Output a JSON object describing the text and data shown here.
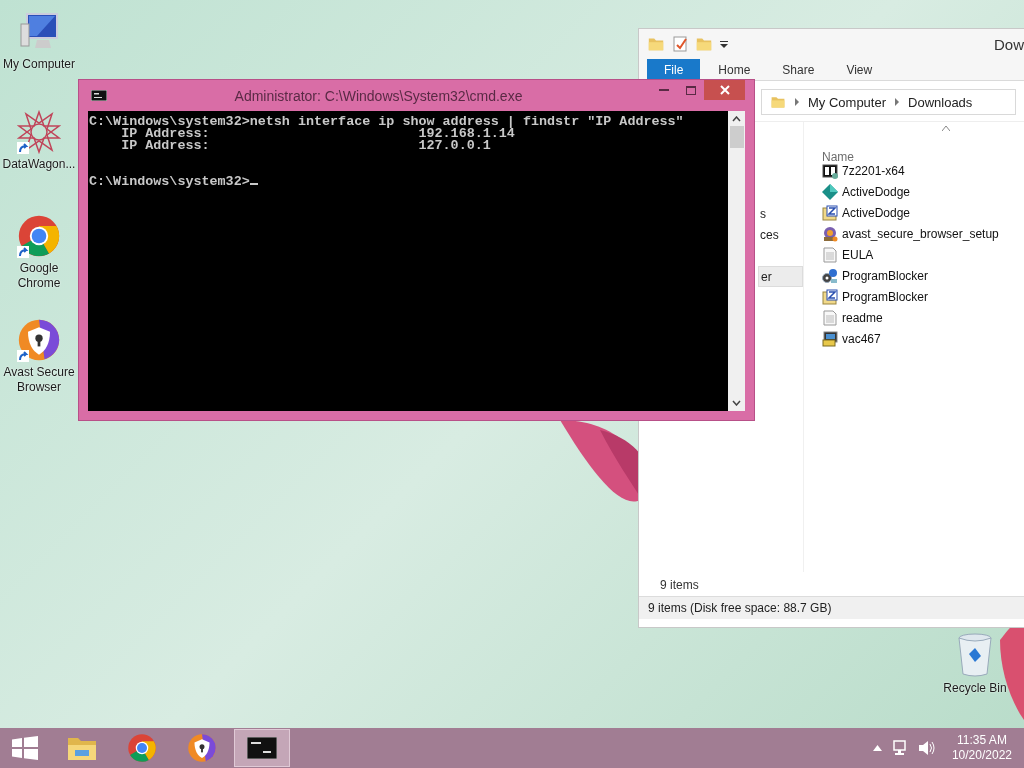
{
  "desktop_icons": [
    {
      "label": "My Computer",
      "kind": "computer",
      "shortcut": false
    },
    {
      "label": "DataWagon...",
      "kind": "star",
      "shortcut": true
    },
    {
      "label": "Google Chrome",
      "kind": "chrome",
      "shortcut": true
    },
    {
      "label": "Avast Secure Browser",
      "kind": "avast",
      "shortcut": true
    }
  ],
  "recycle_bin": {
    "label": "Recycle Bin"
  },
  "explorer": {
    "title": "Dow",
    "ribbon_tabs": [
      {
        "label": "File",
        "kind": "menu",
        "selected": false
      },
      {
        "label": "Home",
        "kind": "tab",
        "selected": false
      },
      {
        "label": "Share",
        "kind": "tab",
        "selected": false
      },
      {
        "label": "View",
        "kind": "tab",
        "selected": false
      }
    ],
    "address": [
      "My Computer",
      "Downloads"
    ],
    "nav_items": [
      {
        "label": "s",
        "selected": false
      },
      {
        "label": "ces",
        "selected": false
      },
      {
        "label": "er",
        "selected": true
      }
    ],
    "column": "Name",
    "files": [
      {
        "name": "7z2201-x64",
        "kind": "sevenzip"
      },
      {
        "name": "ActiveDodge",
        "kind": "gem"
      },
      {
        "name": "ActiveDodge",
        "kind": "archive"
      },
      {
        "name": "avast_secure_browser_setup",
        "kind": "installer"
      },
      {
        "name": "EULA",
        "kind": "text"
      },
      {
        "name": "ProgramBlocker",
        "kind": "gears"
      },
      {
        "name": "ProgramBlocker",
        "kind": "archive"
      },
      {
        "name": "readme",
        "kind": "text"
      },
      {
        "name": "vac467",
        "kind": "setup"
      }
    ],
    "item_count": "9 items",
    "status_bar": "9 items (Disk free space: 88.7 GB)"
  },
  "console": {
    "title": "Administrator: C:\\Windows\\System32\\cmd.exe",
    "lines": [
      "C:\\Windows\\system32>netsh interface ip show address | findstr \"IP Address\"",
      "    IP Address:                          192.168.1.14",
      "    IP Address:                          127.0.0.1"
    ],
    "prompt": "C:\\Windows\\system32>",
    "cursor": true
  },
  "taskbar": {
    "apps": [
      {
        "kind": "explorer",
        "active": false
      },
      {
        "kind": "chrome",
        "active": false
      },
      {
        "kind": "avast",
        "active": false
      },
      {
        "kind": "cmd",
        "active": true
      }
    ],
    "time": "11:35 AM",
    "date": "10/20/2022"
  }
}
